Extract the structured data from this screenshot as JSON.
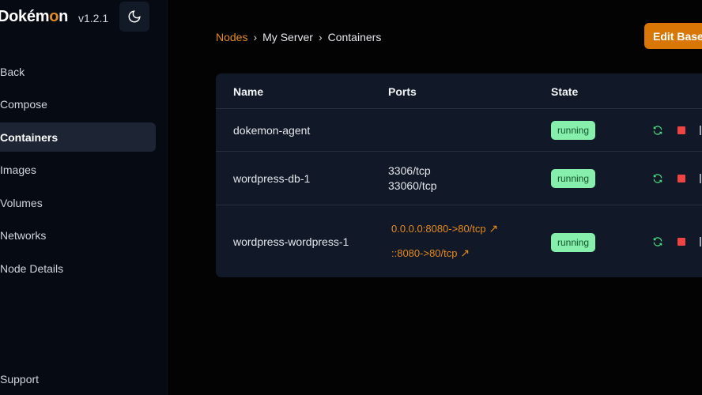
{
  "app": {
    "name_pre": "Dokém",
    "name_o": "o",
    "name_post": "n",
    "version": "v1.2.1"
  },
  "sidebar": {
    "items": [
      {
        "label": "Back"
      },
      {
        "label": "Compose"
      },
      {
        "label": "Containers"
      },
      {
        "label": "Images"
      },
      {
        "label": "Volumes"
      },
      {
        "label": "Networks"
      },
      {
        "label": "Node Details"
      }
    ],
    "support": "Support"
  },
  "breadcrumb": [
    "Nodes",
    "My Server",
    "Containers"
  ],
  "edit_button": "Edit Base U",
  "table": {
    "headers": [
      "Name",
      "Ports",
      "State"
    ],
    "rows": [
      {
        "name": "dokemon-agent",
        "ports": [],
        "state": "running"
      },
      {
        "name": "wordpress-db-1",
        "ports": [
          "3306/tcp",
          "33060/tcp"
        ],
        "state": "running"
      },
      {
        "name": "wordpress-wordpress-1",
        "links": [
          "0.0.0.0:8080->80/tcp",
          "::8080->80/tcp"
        ],
        "state": "running"
      }
    ]
  },
  "colors": {
    "accent": "#e58a1f",
    "running": "#86efac",
    "stop": "#ef4444"
  }
}
